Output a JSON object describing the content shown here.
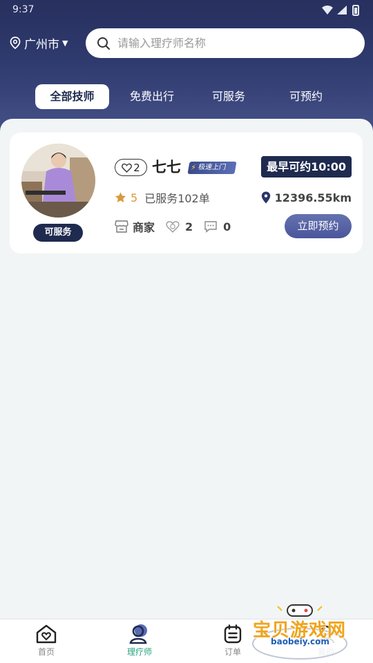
{
  "status_bar": {
    "time": "9:37"
  },
  "search": {
    "city": "广州市",
    "placeholder": "请输入理疗师名称"
  },
  "tabs": [
    {
      "label": "全部技师",
      "active": true
    },
    {
      "label": "免费出行",
      "active": false
    },
    {
      "label": "可服务",
      "active": false
    },
    {
      "label": "可预约",
      "active": false
    }
  ],
  "technicians": [
    {
      "name": "七七",
      "status_badge": "可服务",
      "likes": "2",
      "speed_tag": "极速上门",
      "earliest_label": "最早可约10:00",
      "rating": "5",
      "served": "已服务102单",
      "distance": "12396.55km",
      "merchant_label": "商家",
      "favorites": "2",
      "comments": "0",
      "book_label": "立即预约"
    }
  ],
  "tabbar": [
    {
      "label": "首页",
      "icon": "home-icon",
      "active": false
    },
    {
      "label": "理疗师",
      "icon": "therapist-icon",
      "active": true
    },
    {
      "label": "订单",
      "icon": "order-icon",
      "active": false
    },
    {
      "label": "我的",
      "icon": "profile-icon",
      "active": false
    }
  ],
  "watermark": {
    "title": "宝贝游戏网",
    "url": "baobeiy.com"
  },
  "colors": {
    "header_navy": "#27305e",
    "badge_navy": "#1f2a4f",
    "rating_gold": "#d79a3a",
    "tab_active_green": "#26a37e",
    "button_blue": "#5562a5"
  }
}
